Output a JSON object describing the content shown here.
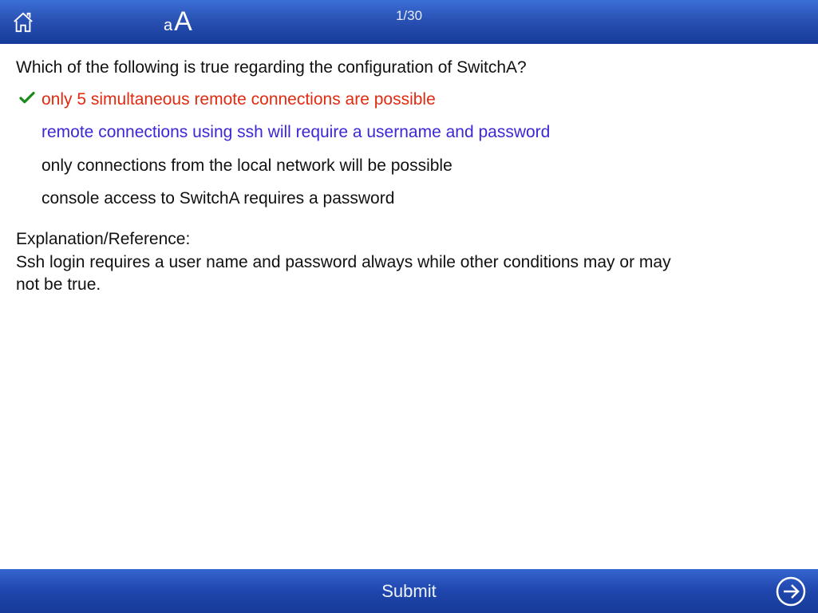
{
  "header": {
    "counter": "1/30"
  },
  "question": "Which of the following is true regarding the configuration of SwitchA?",
  "answers": [
    {
      "text": "only 5 simultaneous remote connections are possible",
      "state": "selected-wrong",
      "checked": true
    },
    {
      "text": "remote connections using ssh will require a username and password",
      "state": "correct",
      "checked": false
    },
    {
      "text": "only connections from the local network will be possible",
      "state": "normal",
      "checked": false
    },
    {
      "text": "console access to SwitchA requires a password",
      "state": "normal",
      "checked": false
    }
  ],
  "explanation": {
    "title": "Explanation/Reference:",
    "body": "Ssh login requires a user name and password always while other conditions may or may not be true."
  },
  "footer": {
    "submit": "Submit"
  }
}
